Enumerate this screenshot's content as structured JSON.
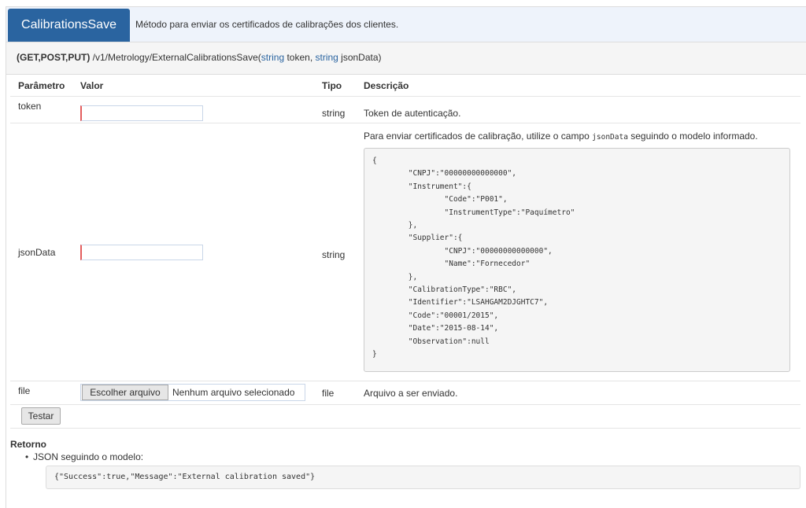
{
  "header": {
    "method_name": "CalibrationsSave",
    "description": "Método para enviar os certificados de calibrações dos clientes."
  },
  "signature": {
    "verbs": "(GET,POST,PUT)",
    "path": " /v1/Metrology/ExternalCalibrationsSave(",
    "param1_type": "string",
    "param1_name": " token, ",
    "param2_type": "string",
    "param2_name": " jsonData)"
  },
  "params_table": {
    "columns": [
      "Parâmetro",
      "Valor",
      "Tipo",
      "Descrição"
    ],
    "rows": [
      {
        "name": "token",
        "value": "",
        "type": "string",
        "description": "Token de autenticação."
      },
      {
        "name": "jsonData",
        "value": "",
        "type": "string",
        "description_prefix": "Para enviar certificados de calibração, utilize o campo ",
        "description_code": "jsonData",
        "description_suffix": " seguindo o modelo informado.",
        "model": "{\n        \"CNPJ\":\"00000000000000\",\n        \"Instrument\":{\n                \"Code\":\"P001\",\n                \"InstrumentType\":\"Paquímetro\"\n        },\n        \"Supplier\":{\n                \"CNPJ\":\"00000000000000\",\n                \"Name\":\"Fornecedor\"\n        },\n        \"CalibrationType\":\"RBC\",\n        \"Identifier\":\"LSAHGAM2DJGHTC7\",\n        \"Code\":\"00001/2015\",\n        \"Date\":\"2015-08-14\",\n        \"Observation\":null\n}"
      },
      {
        "name": "file",
        "file_button": "Escolher arquivo",
        "file_status": "Nenhum arquivo selecionado",
        "type": "file",
        "description": "Arquivo a ser enviado."
      }
    ]
  },
  "test_button": "Testar",
  "return": {
    "title": "Retorno",
    "item": "JSON seguindo o modelo:",
    "model": "{\"Success\":true,\"Message\":\"External calibration saved\"}"
  }
}
